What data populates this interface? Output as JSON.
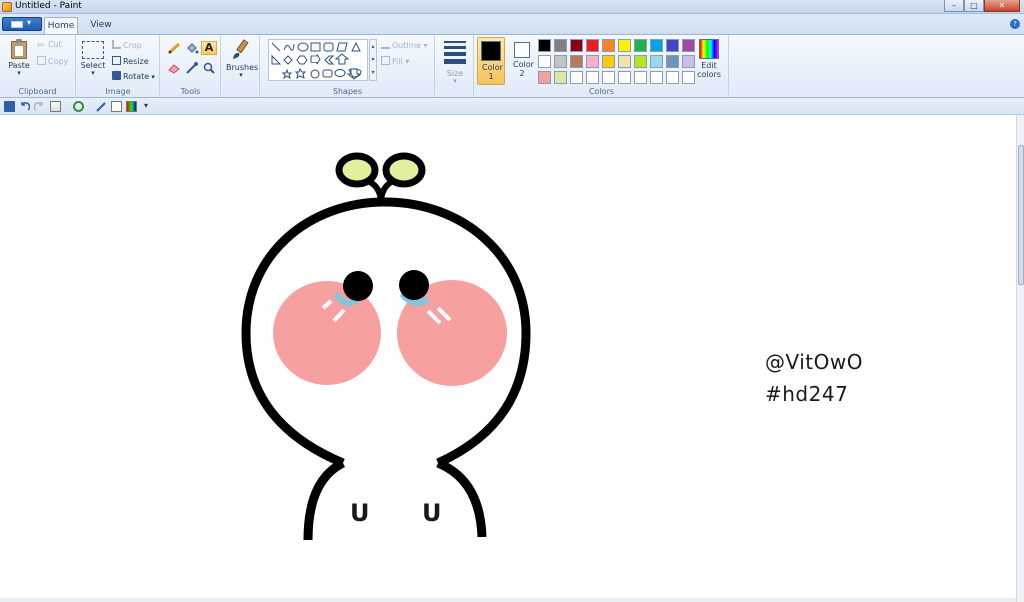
{
  "window": {
    "title": "Untitled - Paint",
    "minimize": "–",
    "maximize": "□",
    "close": "✕"
  },
  "tabs": [
    {
      "label": "Home"
    },
    {
      "label": "View"
    }
  ],
  "help_glyph": "?",
  "clipboard": {
    "paste": "Paste",
    "cut": "Cut",
    "copy": "Copy",
    "label": "Clipboard"
  },
  "image": {
    "select": "Select",
    "crop": "Crop",
    "resize": "Resize",
    "rotate": "Rotate",
    "label": "Image"
  },
  "tools": {
    "label": "Tools",
    "text_glyph": "A"
  },
  "brushes": {
    "label": "Brushes"
  },
  "shapes": {
    "outline": "Outline",
    "fill": "Fill",
    "label": "Shapes"
  },
  "size": {
    "label": "Size"
  },
  "colors": {
    "color1": "Color 1",
    "color2": "Color 2",
    "edit": "Edit colors",
    "label": "Colors",
    "color1_value": "#000000",
    "color2_value": "#ffffff",
    "palette_row1": [
      "#000000",
      "#7f7f7f",
      "#880015",
      "#ed1c24",
      "#ff7f27",
      "#fff200",
      "#22b14c",
      "#00a2e8",
      "#3f48cc",
      "#a349a4"
    ],
    "palette_row2": [
      "#ffffff",
      "#c3c3c3",
      "#b97a57",
      "#ffaec9",
      "#ffc90e",
      "#efe4b0",
      "#b5e61d",
      "#99d9ea",
      "#7092be",
      "#c8bfe7"
    ],
    "palette_row3": [
      "#f4a0a0",
      "#d8e8a0",
      "#ffffff",
      "#ffffff",
      "#ffffff",
      "#ffffff",
      "#ffffff",
      "#ffffff",
      "#ffffff",
      "#ffffff"
    ]
  },
  "drawing": {
    "line1": "@VitOwO",
    "line2": "#hd247",
    "mouth_left": "U",
    "mouth_right": "U",
    "body_stroke": "#000000",
    "blush_color": "#f7a0a0",
    "sprout_color": "#e3ef9c",
    "tear_color": "#7fc6e0"
  }
}
